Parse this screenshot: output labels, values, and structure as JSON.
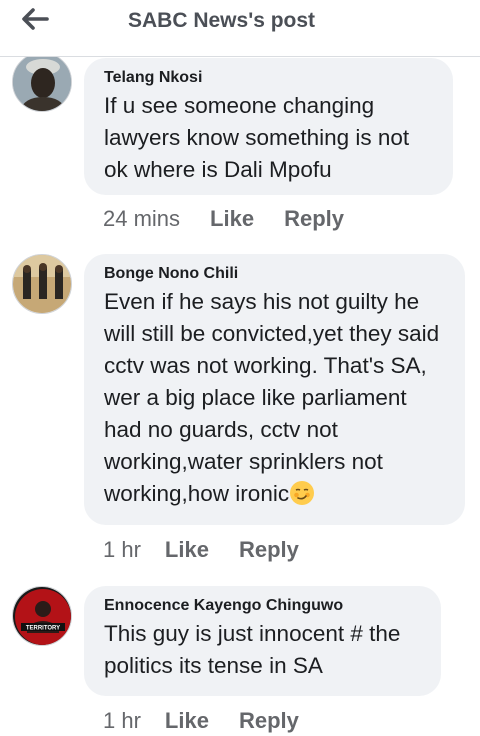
{
  "header": {
    "title": "SABC News's post",
    "back_icon": "arrow-left-icon"
  },
  "comments": [
    {
      "author": "Telang Nkosi",
      "text": "If u see someone changing lawyers know something is not ok where is Dali Mpofu",
      "time": "24 mins",
      "like": "Like",
      "reply": "Reply"
    },
    {
      "author": "Bonge Nono Chili",
      "text": "Even if he says his not guilty he will still be convicted,yet they said cctv was not working. That's SA, wer a big place like parliament had no guards, cctv not working,water sprinklers not working,how ironic",
      "time": "1 hr",
      "like": "Like",
      "reply": "Reply"
    },
    {
      "author": "Ennocence Kayengo Chinguwo",
      "text": "This guy is just innocent # the politics its tense in SA",
      "time": "1 hr",
      "like": "Like",
      "reply": "Reply",
      "avatar_text": "TERRITORY"
    }
  ]
}
